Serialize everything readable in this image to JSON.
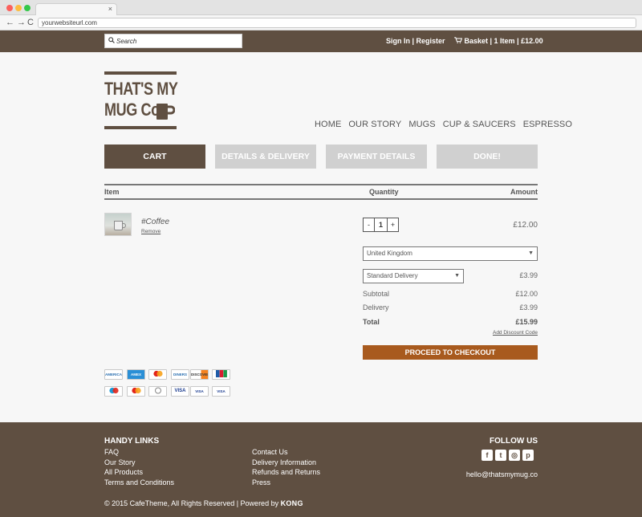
{
  "browser": {
    "url": "yourwebsiteurl.com",
    "tab_close": "×",
    "nav_back": "←",
    "nav_forward": "→",
    "nav_reload": "C"
  },
  "topbar": {
    "search_placeholder": "Search",
    "sign_in": "Sign In",
    "separator": " | ",
    "register": "Register",
    "basket": "Basket | 1 Item | £12.00"
  },
  "logo": {
    "line1": "THAT'S MY",
    "line2": "MUG Co"
  },
  "nav": [
    "HOME",
    "OUR STORY",
    "MUGS",
    "CUP & SAUCERS",
    "ESPRESSO"
  ],
  "steps": [
    "CART",
    "DETAILS & DELIVERY",
    "PAYMENT DETAILS",
    "DONE!"
  ],
  "cart": {
    "headers": {
      "item": "Item",
      "quantity": "Quantity",
      "amount": "Amount"
    },
    "product": {
      "name": "#Coffee",
      "remove": "Remove",
      "quantity": "1",
      "price": "£12.00"
    },
    "qty_minus": "-",
    "qty_plus": "+",
    "country": "United Kingdom",
    "delivery_option": "Standard Delivery",
    "delivery_price": "£3.99",
    "subtotal_label": "Subtotal",
    "subtotal_value": "£12.00",
    "delivery_label": "Delivery",
    "delivery_value": "£3.99",
    "total_label": "Total",
    "total_value": "£15.99",
    "discount": "Add Discount Code",
    "checkout": "PROCEED TO CHECKOUT"
  },
  "payments": [
    "AMERICAN EXPRESS",
    "AMEX",
    "MC",
    "DINERS",
    "DISCOVER",
    "JCB",
    "MAESTRO",
    "MC",
    "",
    "VISA",
    "VISA Debit",
    "VISA Electron"
  ],
  "footer": {
    "handy_links_title": "HANDY LINKS",
    "col1": [
      "FAQ",
      "Our Story",
      "All Products",
      "Terms and Conditions"
    ],
    "col2": [
      "Contact Us",
      "Delivery Information",
      "Refunds and Returns",
      "Press"
    ],
    "follow_title": "FOLLOW US",
    "social": [
      "f",
      "t",
      "◎",
      "p"
    ],
    "email": "hello@thatsmymug.co",
    "copyright": "© 2015 CafeTheme, All Rights Reserved | Powered by ",
    "powered_by": "KONG"
  },
  "colors": {
    "brand_brown": "#5f4f41",
    "checkout_orange": "#a85a1e",
    "inactive_step": "#d0d0d0"
  }
}
